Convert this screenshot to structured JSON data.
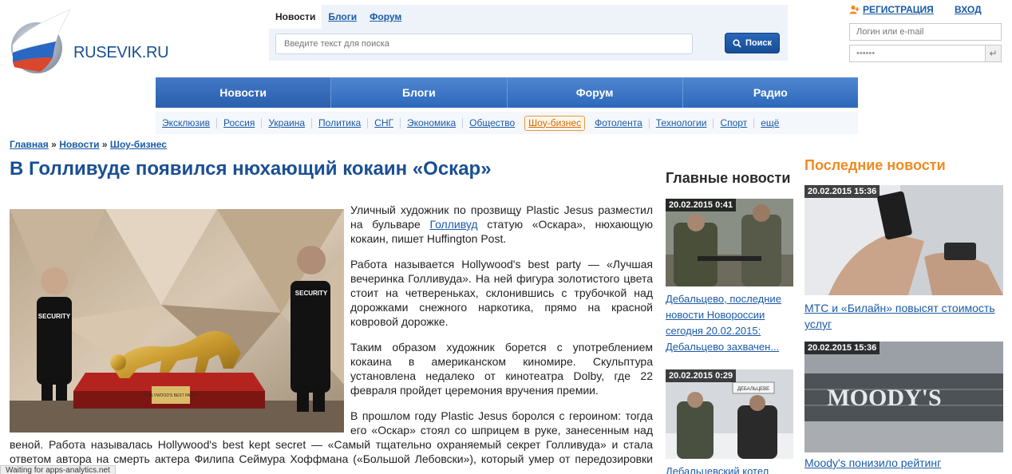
{
  "logo": {
    "text": "RUSEVIK.RU"
  },
  "search": {
    "tabs": [
      "Новости",
      "Блоги",
      "Форум"
    ],
    "placeholder": "Введите текст для поиска",
    "button_label": "Поиск"
  },
  "auth": {
    "register_label": "РЕГИСТРАЦИЯ",
    "login_label": "ВХОД",
    "login_placeholder": "Логин или e-mail",
    "password_value": "••••••"
  },
  "main_nav": [
    "Новости",
    "Блоги",
    "Форум",
    "Радио"
  ],
  "sub_nav": {
    "items": [
      "Эксклюзив",
      "Россия",
      "Украина",
      "Политика",
      "СНГ",
      "Экономика",
      "Общество",
      "Шоу-бизнес",
      "Фотолента",
      "Технологии",
      "Спорт",
      "ещё"
    ],
    "active": "Шоу-бизнес"
  },
  "breadcrumb": {
    "items": [
      "Главная",
      "Новости",
      "Шоу-бизнес"
    ],
    "separator": "»"
  },
  "article": {
    "title": "В Голливуде появился нюхающий кокаин «Оскар»",
    "image_caption_plate": "HOLLYWOOD'S BEST PARTY",
    "security_label": "SECURITY",
    "p1_before": "Уличный художник по прозвищу Plastic Jesus разместил на бульваре ",
    "p1_link": "Голливуд",
    "p1_after": " статую «Оскара», нюхающую кокаин, пишет Huffington Post.",
    "p2": "Работа называется Hollywood's best party — «Лучшая вечеринка Голливуда». На ней фигура золотистого цвета стоит на четвереньках, склонившись с трубочкой над дорожками снежного наркотика, прямо на красной ковровой дорожке.",
    "p3": "Таким образом художник борется с употреблением кокаина в американском киномире. Скульптура установлена недалеко от кинотеатра Dolby, где 22 февраля пройдет церемония вручения премии.",
    "p4": "В прошлом году Plastic Jesus боролся с героином: тогда его «Оскар» стоял со шприцем в руке, занесенным над веной. Работа называлась Hollywood's best kept secret — «Самый тщательно охраняемый секрет Голливуда» и стала ответом автора на смерть актера Филипа Сеймура Хоффмана («Большой Лебовски»), который умер от передозировки героина."
  },
  "main_news": {
    "title": "Главные новости",
    "items": [
      {
        "date": "20.02.2015 0:41",
        "headline": "Дебальцево, последние новости Новороссии сегодня 20.02.2015: Дебальцево захвачен..."
      },
      {
        "date": "20.02.2015 0:29",
        "headline": "Дебальцевский котел",
        "sign_text": "ДЕБАЛЬЦЕВЕ"
      }
    ]
  },
  "latest_news": {
    "title": "Последние новости",
    "items": [
      {
        "date": "20.02.2015 15:36",
        "headline": "МТС и «Билайн» повысят стоимость услуг"
      },
      {
        "date": "20.02.2015 15:36",
        "headline": "Moody's понизило рейтинг",
        "image_text": "MOODY'S"
      }
    ]
  },
  "status_bar": "Waiting for apps-analytics.net",
  "colors": {
    "brand_blue": "#1a4f93",
    "link": "#1a5aa6",
    "accent_orange": "#f08a1f"
  }
}
